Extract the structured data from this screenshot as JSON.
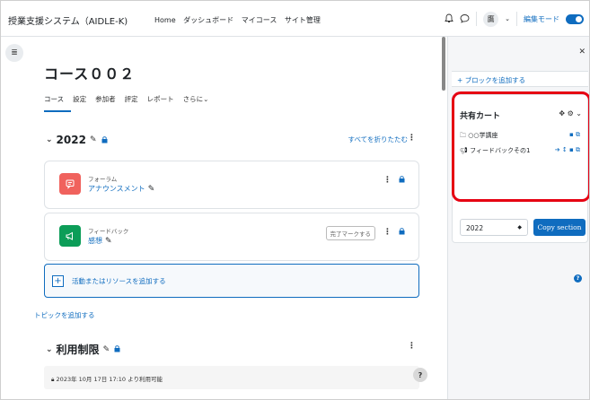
{
  "navbar": {
    "brand": "授業支援システム（AIDLE-K)",
    "links": [
      "Home",
      "ダッシュボード",
      "マイコース",
      "サイト管理"
    ],
    "avatar": "鷹",
    "edit_mode_label": "編集モード",
    "icons": [
      "bell-icon",
      "chat-icon",
      "chevron-down-icon"
    ]
  },
  "drawer_toggle_icon": "list-icon",
  "course": {
    "title": "コース００２",
    "tabs": [
      "コース",
      "設定",
      "参加者",
      "評定",
      "レポート",
      "さらに"
    ]
  },
  "section2022": {
    "title": "2022",
    "collapse_all": "すべてを折りたたむ",
    "activities": [
      {
        "type": "フォーラム",
        "name": "アナウンスメント",
        "color": "#f0625d",
        "icon": "forum-icon"
      },
      {
        "type": "フィードバック",
        "name": "感想",
        "color": "#0c9d58",
        "icon": "megaphone-icon",
        "mark_button": "完了マークする"
      }
    ],
    "add_activity": "活動またはリソースを追加する"
  },
  "add_topic": "トピックを追加する",
  "section_restrict": {
    "title": "利用制限",
    "restriction_text": "2023年 10月 17日 17:10 より利用可能"
  },
  "drawer": {
    "add_block": "ブロックを追加する",
    "sharing_cart": {
      "title": "共有カート",
      "items": [
        {
          "name": "○○学講座",
          "icon": "folder-icon"
        },
        {
          "name": "フィードバックその1",
          "icon": "megaphone-icon"
        }
      ],
      "year_option": "2022",
      "copy_button": "Copy section"
    }
  },
  "colors": {
    "accent": "#0f6cbf",
    "highlight": "#e60012"
  }
}
